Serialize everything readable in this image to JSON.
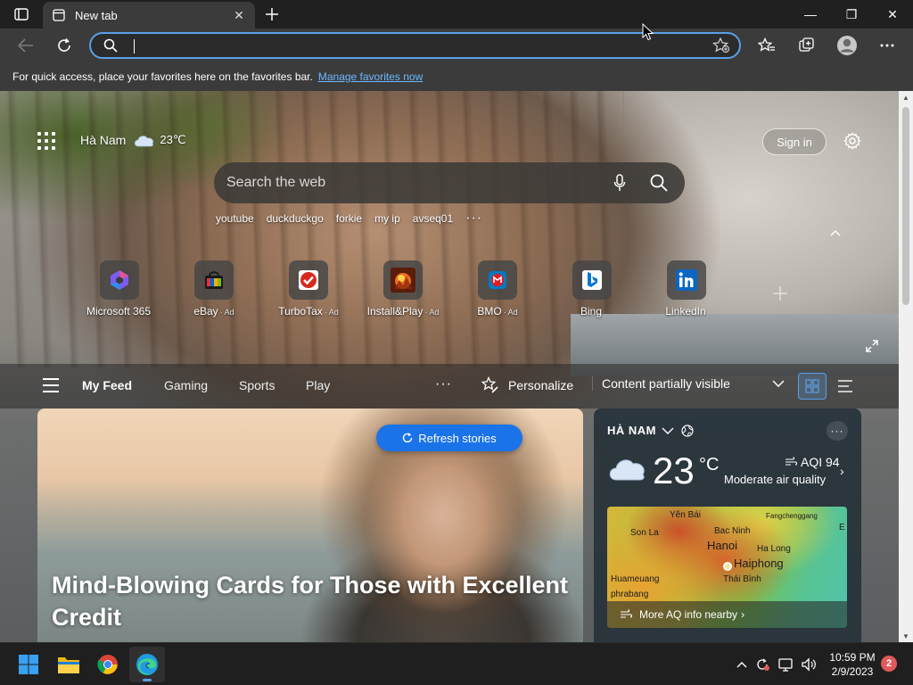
{
  "browser": {
    "tab": {
      "title": "New tab"
    },
    "window_controls": {
      "minimize": "—",
      "restore": "❐",
      "close": "✕"
    },
    "address": {
      "value": ""
    },
    "favorites_bar": {
      "message": "For quick access, place your favorites here on the favorites bar.",
      "link": "Manage favorites now"
    }
  },
  "newtab": {
    "weather_mini": {
      "location": "Hà Nam",
      "temp": "23℃"
    },
    "signin_label": "Sign in",
    "search": {
      "placeholder": "Search the web"
    },
    "quick_searches": [
      "youtube",
      "duckduckgo",
      "forkie",
      "my ip",
      "avseq01"
    ],
    "quick_more": "···",
    "tiles": [
      {
        "label": "Microsoft 365",
        "ad": ""
      },
      {
        "label": "eBay",
        "ad": "· Ad"
      },
      {
        "label": "TurboTax",
        "ad": "· Ad"
      },
      {
        "label": "Install&Play",
        "ad": "· Ad"
      },
      {
        "label": "BMO",
        "ad": "· Ad"
      },
      {
        "label": "Bing",
        "ad": ""
      },
      {
        "label": "LinkedIn",
        "ad": ""
      }
    ],
    "feed_tabs": [
      "My Feed",
      "Gaming",
      "Sports",
      "Play"
    ],
    "feed_more": "···",
    "personalize_label": "Personalize",
    "visibility_label": "Content partially visible",
    "hero": {
      "refresh_label": "Refresh stories",
      "headline": "Mind-Blowing Cards for Those with Excellent Credit"
    },
    "weather_card": {
      "location": "HÀ NAM",
      "more": "···",
      "temp": "23",
      "unit": "°C",
      "aqi": "AQI 94",
      "aqi_desc": "Moderate air quality",
      "map_labels": {
        "yen_bai": "Yên Bái",
        "son_la": "Son La",
        "bac_ninh": "Bac Ninh",
        "hanoi": "Hanoi",
        "ha_long": "Ha Long",
        "fangchenggang": "Fangchenggang",
        "huameuang": "Huameuang",
        "haiphong": "Haiphong",
        "thai_binh": "Thái Bình",
        "phrabang": "phrabang",
        "edge_e": "E"
      },
      "map_footer": "More AQ info nearby"
    }
  },
  "taskbar": {
    "time": "10:59 PM",
    "date": "2/9/2023",
    "notifications": "2"
  },
  "colors": {
    "accent": "#1a73e8",
    "focus_ring": "#5aa0e6",
    "link": "#6cb8ff"
  }
}
